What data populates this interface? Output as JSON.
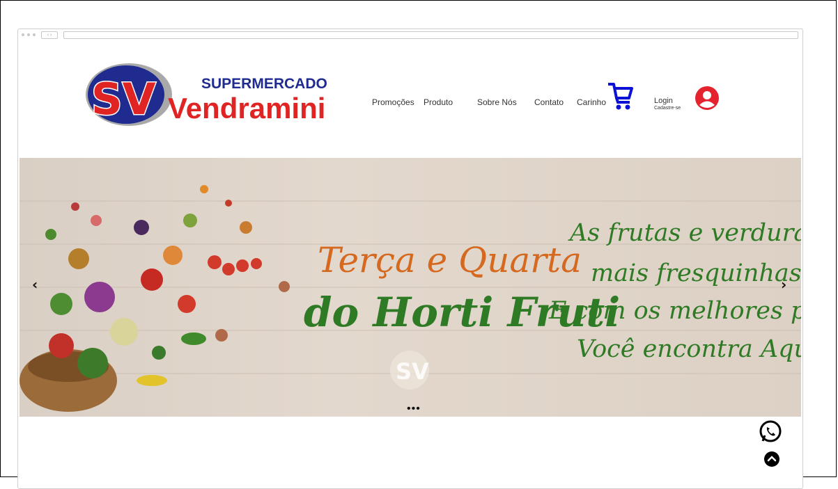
{
  "logo": {
    "supermercado": "SUPERMERCADO",
    "sv": "SV",
    "vendramini": "Vendramini"
  },
  "nav": {
    "promocoes": "Promoções",
    "produto": "Produto",
    "sobre_nos": "Sobre Nós",
    "contato": "Contato",
    "carinho": "Carinho"
  },
  "account": {
    "login": "Login",
    "signup": "Cadastre-se"
  },
  "banner": {
    "headline_1": "Terça e Quarta",
    "headline_2": "do Horti Fruti",
    "tagline_lines": [
      "As frutas e verduras",
      "mais fresquinhas",
      "E com os melhores preços",
      "Você encontra Aqui!"
    ],
    "watermark": "SV",
    "prev_arrow": "‹",
    "next_arrow": "›",
    "dots": "•••"
  },
  "colors": {
    "brand_blue": "#1f2b8f",
    "brand_red": "#e02424",
    "cart_blue": "#0b12d6",
    "user_red": "#e5232f",
    "banner_orange": "#d4691f",
    "banner_green": "#2f7a24"
  },
  "icons": [
    "cart-icon",
    "user-icon",
    "whatsapp-icon",
    "scroll-top-icon",
    "chevron-left-icon",
    "chevron-right-icon"
  ]
}
